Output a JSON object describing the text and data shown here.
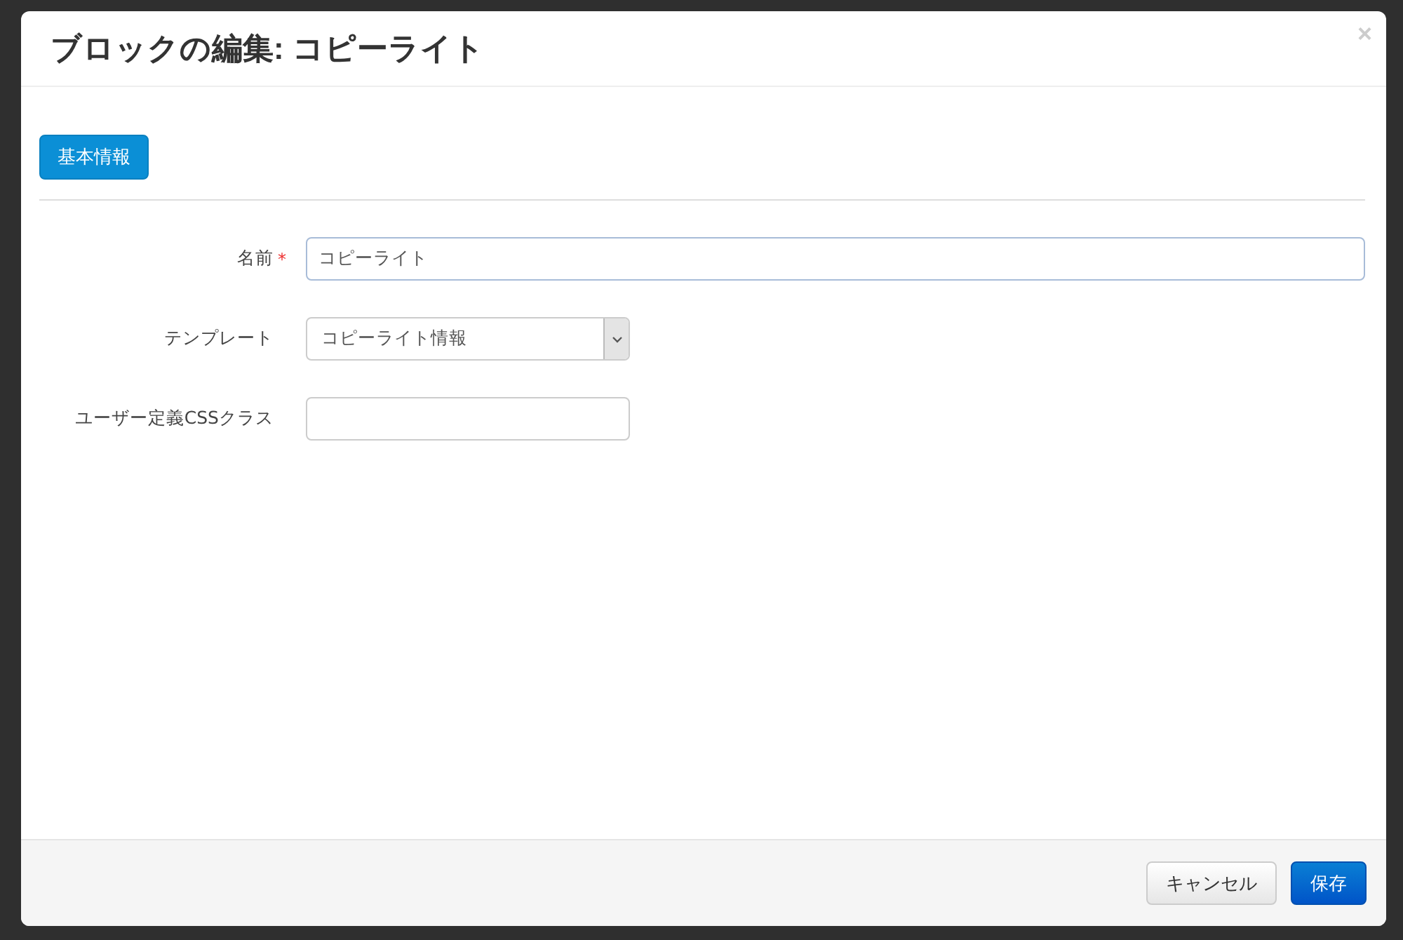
{
  "dialog": {
    "title": "ブロックの編集: コピーライト",
    "close": "×"
  },
  "tabs": [
    {
      "label": "基本情報",
      "selected": true
    }
  ],
  "fields": [
    {
      "kind": "wide-text",
      "label": "名前",
      "required_mark": "*",
      "value": "コピーライト"
    },
    {
      "kind": "select",
      "label": "テンプレート",
      "value": "コピーライト情報"
    },
    {
      "kind": "text",
      "label": "ユーザー定義CSSクラス"
    }
  ],
  "buttons": [
    {
      "label": "キャンセル",
      "kind": "default"
    },
    {
      "label": "保存",
      "kind": "primary"
    }
  ]
}
